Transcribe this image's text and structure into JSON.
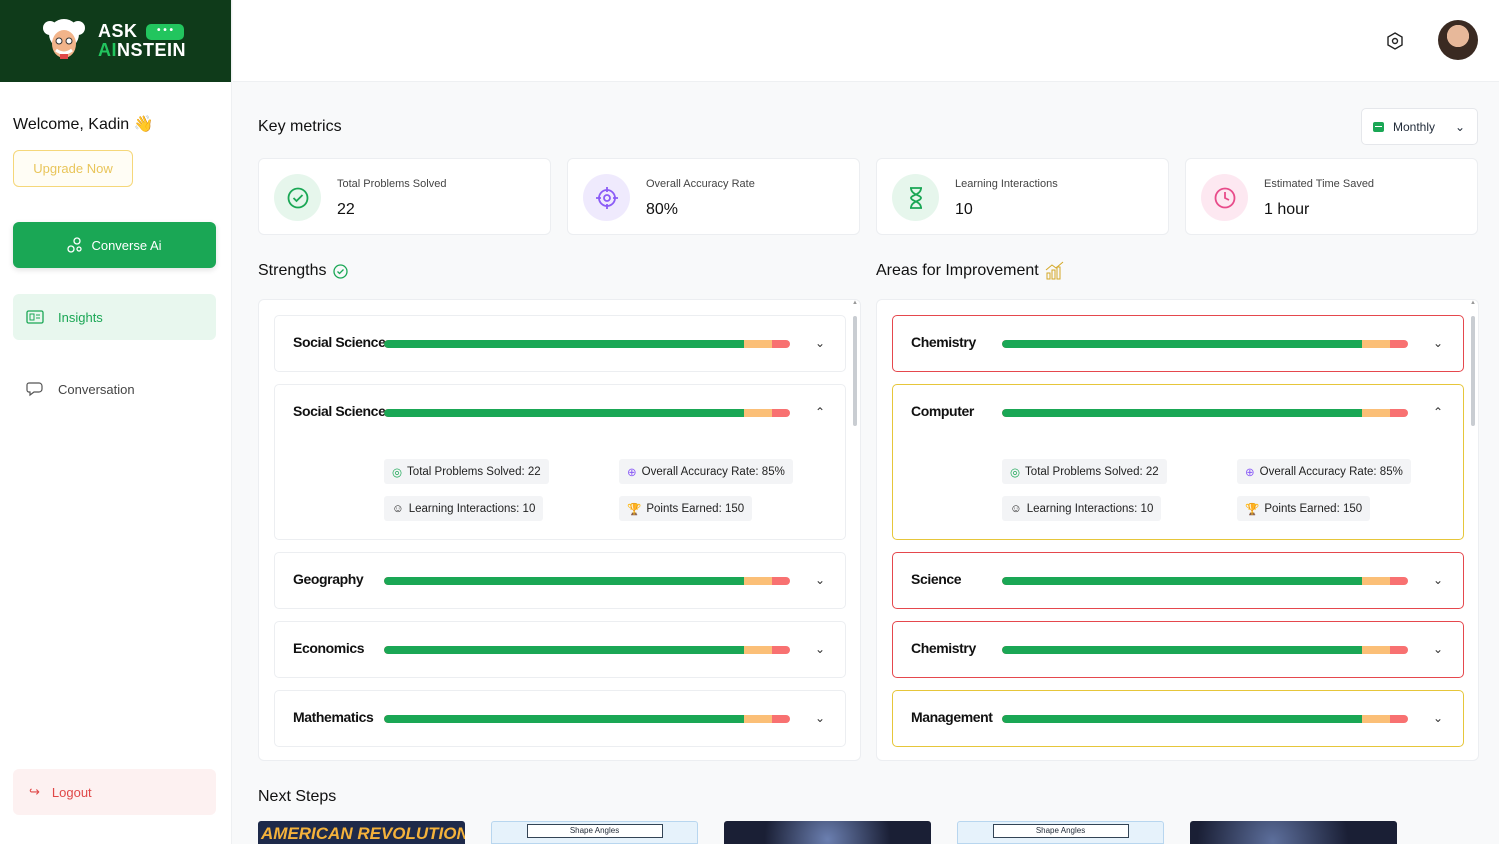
{
  "app": {
    "brand_line1": "ASK",
    "brand_line2_a": "AI",
    "brand_line2_b": "NSTEIN",
    "bubble": "• • •"
  },
  "sidebar": {
    "welcome": "Welcome, Kadin 👋",
    "upgrade_label": "Upgrade Now",
    "converse_label": "Converse Ai",
    "items": [
      {
        "label": "Insights",
        "active": true
      },
      {
        "label": "Conversation",
        "active": false
      }
    ],
    "logout_label": "Logout"
  },
  "main": {
    "key_metrics_title": "Key metrics",
    "period": "Monthly",
    "metrics": [
      {
        "label": "Total Problems Solved",
        "value": "22",
        "icon": "check-circle-icon",
        "color": "#1aa755"
      },
      {
        "label": "Overall Accuracy Rate",
        "value": "80%",
        "icon": "target-icon",
        "color": "#8b5cf6"
      },
      {
        "label": "Learning Interactions",
        "value": "10",
        "icon": "hourglass-icon",
        "color": "#1aa755"
      },
      {
        "label": "Estimated Time Saved",
        "value": "1 hour",
        "icon": "clock-icon",
        "color": "#e84b8a"
      }
    ],
    "strengths_title": "Strengths",
    "improvement_title": "Areas for Improvement",
    "strengths": [
      {
        "name": "Social Science",
        "green": 0.885,
        "orange": 0.07,
        "expanded": false
      },
      {
        "name": "Social Science",
        "green": 0.885,
        "orange": 0.07,
        "expanded": true
      },
      {
        "name": "Geography",
        "green": 0.885,
        "orange": 0.07,
        "expanded": false
      },
      {
        "name": "Economics",
        "green": 0.885,
        "orange": 0.07,
        "expanded": false
      },
      {
        "name": "Mathematics",
        "green": 0.885,
        "orange": 0.07,
        "expanded": false
      }
    ],
    "improvements": [
      {
        "name": "Chemistry",
        "border": "red"
      },
      {
        "name": "Computer",
        "border": "yellow",
        "expanded": true
      },
      {
        "name": "Science",
        "border": "red"
      },
      {
        "name": "Chemistry",
        "border": "red"
      },
      {
        "name": "Management",
        "border": "yellow"
      }
    ],
    "details": {
      "problems": "Total Problems Solved: 22",
      "accuracy": "Overall Accuracy Rate: 85%",
      "interactions": "Learning Interactions: 10",
      "points": "Points Earned: 150"
    },
    "next_steps_title": "Next Steps",
    "next_steps": [
      {
        "label": "AMERICAN REVOLUTION"
      },
      {
        "label": "Shape Angles"
      },
      {
        "label": ""
      },
      {
        "label": "Shape Angles"
      },
      {
        "label": ""
      }
    ]
  }
}
